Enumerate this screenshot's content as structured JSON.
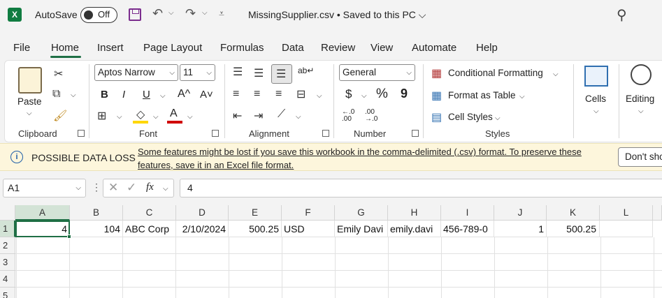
{
  "titlebar": {
    "app_icon": "excel-icon",
    "autosave_label": "AutoSave",
    "autosave_state": "Off",
    "doc_title": "MissingSupplier.csv • Saved to this PC ⌵"
  },
  "menu": {
    "tabs": [
      "File",
      "Home",
      "Insert",
      "Page Layout",
      "Formulas",
      "Data",
      "Review",
      "View",
      "Automate",
      "Help"
    ],
    "active_tab": "Home"
  },
  "ribbon": {
    "clipboard": {
      "paste": "Paste",
      "group": "Clipboard"
    },
    "font": {
      "family": "Aptos Narrow",
      "size": "11",
      "group": "Font",
      "bold": "B",
      "italic": "I",
      "underline": "U",
      "grow": "A^",
      "shrink": "A˅",
      "fill_color": "#ffd700",
      "font_color": "#d00000"
    },
    "alignment": {
      "group": "Alignment"
    },
    "number": {
      "format": "General",
      "currency": "$",
      "percent": "%",
      "comma": "9",
      "inc_dec": "←.0 .00",
      "dec_dec": ".00 →.0",
      "group": "Number"
    },
    "styles": {
      "conditional": "Conditional Formatting",
      "table": "Format as Table",
      "cell_styles": "Cell Styles",
      "group": "Styles"
    },
    "cells": {
      "label": "Cells"
    },
    "editing": {
      "label": "Editing"
    }
  },
  "infobar": {
    "title": "POSSIBLE DATA LOSS",
    "message": "Some features might be lost if you save this workbook in the comma-delimited (.csv) format. To preserve these features, save it in an Excel file format.",
    "button": "Don't show again"
  },
  "formulabar": {
    "namebox": "A1",
    "fx": "fx",
    "value": "4"
  },
  "grid": {
    "columns": [
      "A",
      "B",
      "C",
      "D",
      "E",
      "F",
      "G",
      "H",
      "I",
      "J",
      "K",
      "L"
    ],
    "rows": [
      "1",
      "2",
      "3",
      "4",
      "5"
    ],
    "row1": [
      "4",
      "104",
      "ABC Corp",
      "2/10/2024",
      "500.25",
      "USD",
      "Emily Davi",
      "emily.davi",
      "456-789-0",
      "1",
      "500.25",
      ""
    ]
  }
}
